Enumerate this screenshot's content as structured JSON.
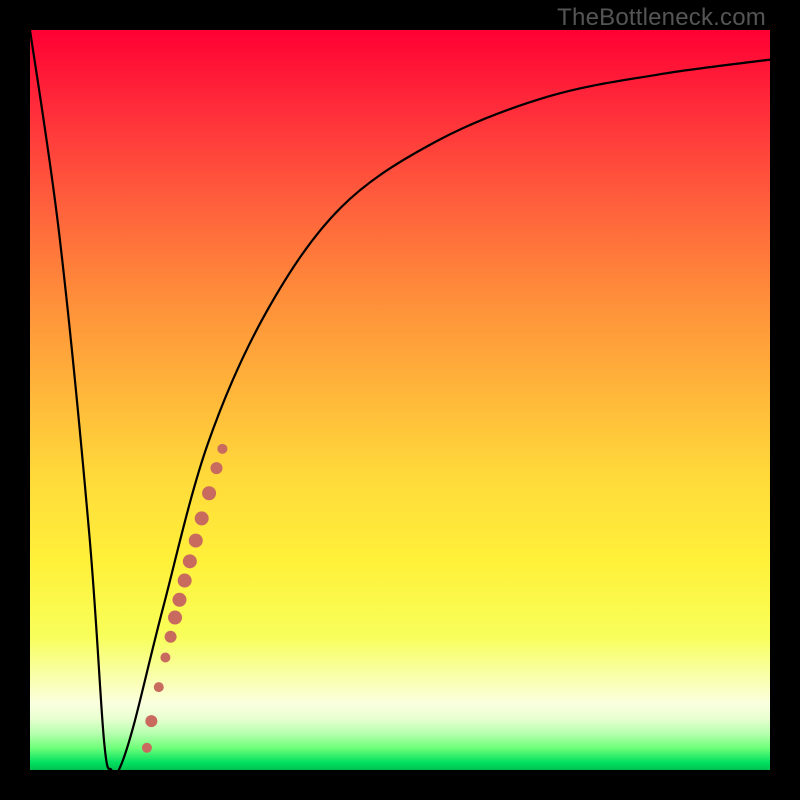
{
  "watermark": "TheBottleneck.com",
  "colors": {
    "frame": "#000000",
    "curve": "#000000",
    "dots": "#c96a5f"
  },
  "chart_data": {
    "type": "line",
    "title": "",
    "xlabel": "",
    "ylabel": "",
    "xlim": [
      0,
      100
    ],
    "ylim": [
      0,
      100
    ],
    "grid": false,
    "series": [
      {
        "name": "bottleneck-curve",
        "x": [
          0,
          4,
          8,
          10,
          11,
          12,
          14,
          18,
          24,
          32,
          42,
          55,
          70,
          85,
          100
        ],
        "values": [
          100,
          72,
          32,
          4,
          0,
          0,
          6,
          22,
          44,
          62,
          76,
          85,
          91,
          94,
          96
        ]
      }
    ],
    "annotations": {
      "dots": [
        {
          "x": 15.8,
          "y": 3.0,
          "r": 5
        },
        {
          "x": 16.4,
          "y": 6.6,
          "r": 6
        },
        {
          "x": 17.4,
          "y": 11.2,
          "r": 5
        },
        {
          "x": 18.3,
          "y": 15.2,
          "r": 5
        },
        {
          "x": 19.0,
          "y": 18.0,
          "r": 6
        },
        {
          "x": 19.6,
          "y": 20.6,
          "r": 7
        },
        {
          "x": 20.2,
          "y": 23.0,
          "r": 7
        },
        {
          "x": 20.9,
          "y": 25.6,
          "r": 7
        },
        {
          "x": 21.6,
          "y": 28.2,
          "r": 7
        },
        {
          "x": 22.4,
          "y": 31.0,
          "r": 7
        },
        {
          "x": 23.2,
          "y": 34.0,
          "r": 7
        },
        {
          "x": 24.2,
          "y": 37.4,
          "r": 7
        },
        {
          "x": 25.2,
          "y": 40.8,
          "r": 6
        },
        {
          "x": 26.0,
          "y": 43.4,
          "r": 5
        }
      ]
    }
  }
}
